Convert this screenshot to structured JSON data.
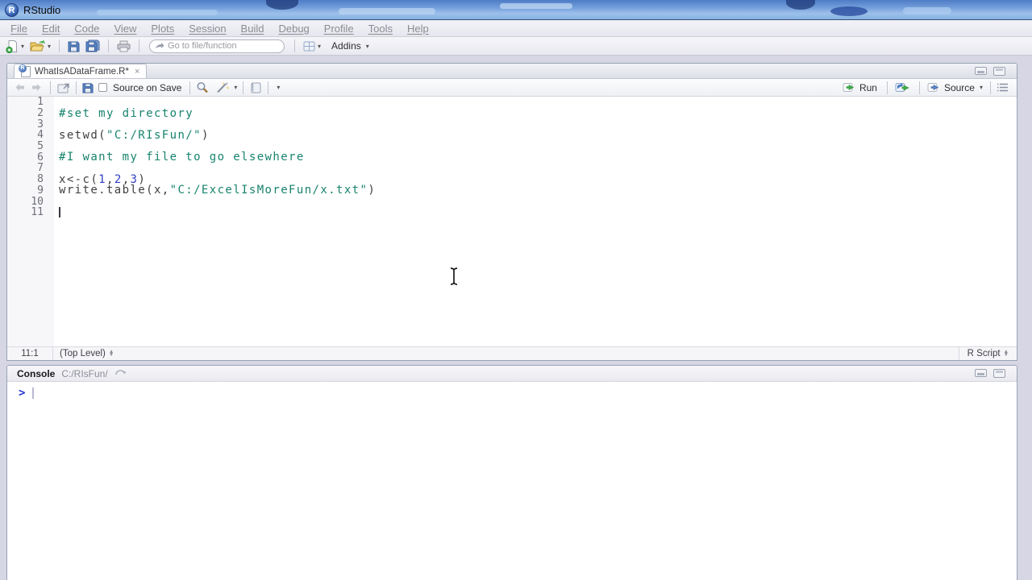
{
  "colors": {
    "comment": "#17836d",
    "string": "#17836d",
    "number": "#3142c4",
    "code_default": "#3f3f3f",
    "prompt": "#2433cf"
  },
  "window": {
    "title": "RStudio"
  },
  "menu_bar": {
    "items": [
      "File",
      "Edit",
      "Code",
      "View",
      "Plots",
      "Session",
      "Build",
      "Debug",
      "Profile",
      "Tools",
      "Help"
    ]
  },
  "main_toolbar": {
    "goto_input": {
      "placeholder": "Go to file/function"
    },
    "addins_label": "Addins"
  },
  "source_pane": {
    "tab": {
      "title": "WhatIsADataFrame.R*",
      "close_glyph": "×"
    },
    "editor_toolbar": {
      "source_on_save_label": "Source on Save",
      "run_label": "Run",
      "source_label": "Source"
    },
    "code_lines": [
      {
        "n": "1",
        "segments": []
      },
      {
        "n": "2",
        "segments": [
          {
            "text": "#set my directory",
            "type": "comment"
          }
        ]
      },
      {
        "n": "3",
        "segments": []
      },
      {
        "n": "4",
        "segments": [
          {
            "text": "setwd(",
            "type": "plain"
          },
          {
            "text": "\"C:/RIsFun/\"",
            "type": "string"
          },
          {
            "text": ")",
            "type": "plain"
          }
        ]
      },
      {
        "n": "5",
        "segments": []
      },
      {
        "n": "6",
        "segments": [
          {
            "text": "#I want my file to go elsewhere",
            "type": "comment"
          }
        ]
      },
      {
        "n": "7",
        "segments": []
      },
      {
        "n": "8",
        "segments": [
          {
            "text": "x<-c(",
            "type": "plain"
          },
          {
            "text": "1",
            "type": "number"
          },
          {
            "text": ",",
            "type": "plain"
          },
          {
            "text": "2",
            "type": "number"
          },
          {
            "text": ",",
            "type": "plain"
          },
          {
            "text": "3",
            "type": "number"
          },
          {
            "text": ")",
            "type": "plain"
          }
        ]
      },
      {
        "n": "9",
        "segments": [
          {
            "text": "write.table(x,",
            "type": "plain"
          },
          {
            "text": "\"C:/ExcelIsMoreFun/x.txt\"",
            "type": "string"
          },
          {
            "text": ")",
            "type": "plain"
          }
        ]
      },
      {
        "n": "10",
        "segments": []
      },
      {
        "n": "11",
        "segments": [],
        "cursor": true
      }
    ],
    "status_bar": {
      "cursor_position": "11:1",
      "scope": "(Top Level)",
      "file_type": "R Script"
    }
  },
  "console_pane": {
    "title": "Console",
    "working_directory": "C:/RIsFun/",
    "prompt": ">"
  }
}
